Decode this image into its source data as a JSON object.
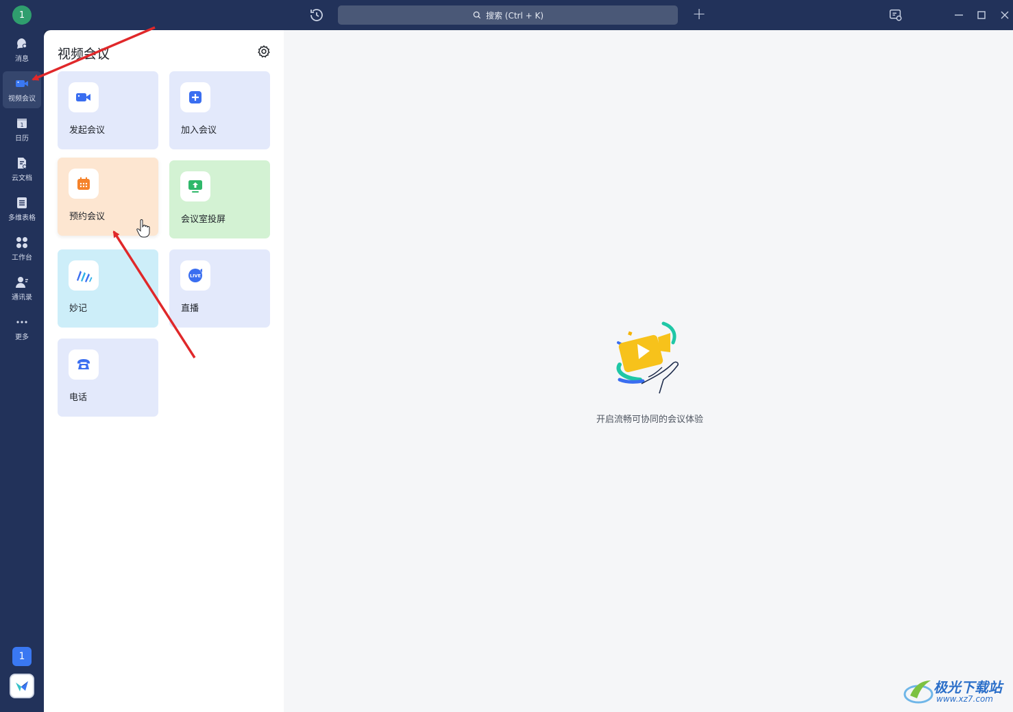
{
  "titlebar": {
    "avatar_text": "1",
    "search_placeholder": "搜索 (Ctrl + K)"
  },
  "nav": {
    "items": [
      {
        "label": "消息",
        "icon": "chat-bubble-icon"
      },
      {
        "label": "视频会议",
        "icon": "video-camera-icon",
        "active": true
      },
      {
        "label": "日历",
        "icon": "calendar-icon"
      },
      {
        "label": "云文档",
        "icon": "cloud-doc-icon"
      },
      {
        "label": "多维表格",
        "icon": "table-icon"
      },
      {
        "label": "工作台",
        "icon": "workbench-grid-icon"
      },
      {
        "label": "通讯录",
        "icon": "contacts-icon"
      },
      {
        "label": "更多",
        "icon": "more-dots-icon"
      }
    ],
    "badge_text": "1"
  },
  "panel": {
    "title": "视频会议",
    "cards": [
      {
        "label": "发起会议",
        "color": "#e3e9fb",
        "icon": "start-meeting-camera-icon"
      },
      {
        "label": "加入会议",
        "color": "#e3e9fb",
        "icon": "join-meeting-plus-icon"
      },
      {
        "label": "预约会议",
        "color": "#fde6d1",
        "icon": "schedule-calendar-icon"
      },
      {
        "label": "会议室投屏",
        "color": "#d3f2d3",
        "icon": "screen-share-icon"
      },
      {
        "label": "妙记",
        "color": "#cdeef9",
        "icon": "minutes-icon"
      },
      {
        "label": "直播",
        "color": "#e3e9fb",
        "icon": "live-icon"
      },
      {
        "label": "电话",
        "color": "#e3e9fb",
        "icon": "phone-icon"
      }
    ]
  },
  "content": {
    "empty_text": "开启流畅可协同的会议体验"
  },
  "watermark": {
    "text": "极光下载站",
    "url": "www.xz7.com"
  },
  "colors": {
    "sidebar_bg": "#22325a",
    "accent_blue": "#3a78f2",
    "annotation_red": "#e0282a"
  }
}
